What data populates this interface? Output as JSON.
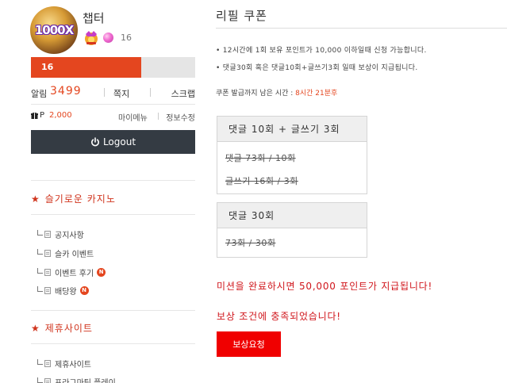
{
  "profile": {
    "avatar_text": "1000X",
    "nickname": "챕터",
    "level": "16",
    "progress_label": "16",
    "progress_fraction": 0.67
  },
  "stats": {
    "alarm_label": "알림",
    "alarm_count": "3499",
    "memo_label": "쪽지",
    "scrap_label": "스크랩"
  },
  "points": {
    "label": "P",
    "value": "2,000",
    "my_menu": "마이메뉴",
    "edit_info": "정보수정"
  },
  "logout": {
    "label": "Logout"
  },
  "sections": [
    {
      "title": "슬기로운 카지노",
      "items": [
        {
          "label": "공지사항",
          "new": false
        },
        {
          "label": "슬카 이벤트",
          "new": false
        },
        {
          "label": "이벤트 후기",
          "new": true,
          "badge": "N"
        },
        {
          "label": "배당왕",
          "new": true,
          "badge": "N"
        }
      ]
    },
    {
      "title": "제휴사이트",
      "items": [
        {
          "label": "제휴사이트",
          "new": false
        },
        {
          "label": "프라그마틱 플레이",
          "new": false
        }
      ]
    }
  ],
  "main": {
    "title": "리필 쿠폰",
    "notes": [
      "12시간에 1회 보유 포인트가 10,000 이하일때 신청 가능합니다.",
      "댓글30회 혹은 댓글10회+글쓰기3회 일때 보상이 지급됩니다."
    ],
    "time_label": "쿠폰 발급까지 남은 시간 : ",
    "time_value": "8시간 21분후",
    "quests": [
      {
        "title": "댓글 10회 + 글쓰기 3회",
        "lines": [
          "댓글 73회 / 10회",
          "글쓰기 16회 / 3회"
        ]
      },
      {
        "title": "댓글 30회",
        "lines": [
          "73회 / 30회"
        ]
      }
    ],
    "complete_message": "미션을 완료하시면 50,000 포인트가 지급됩니다!",
    "satisfied_message": "보상 조건에 충족되었습니다!",
    "reward_button": "보상요청"
  },
  "colors": {
    "accent": "#e4461f",
    "logout_bg": "#343b43",
    "reward_button": "#f00000",
    "alert_text": "#d0151b"
  }
}
